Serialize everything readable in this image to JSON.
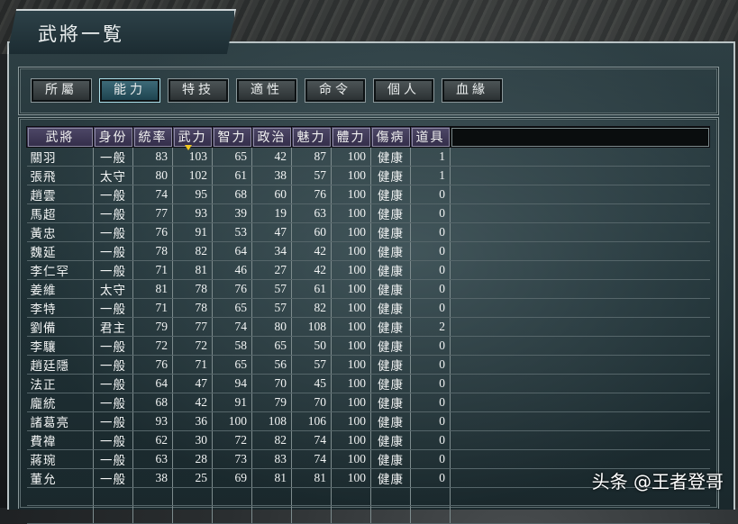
{
  "window": {
    "title": "武將一覧"
  },
  "tabs": [
    {
      "label": "所屬",
      "active": false
    },
    {
      "label": "能力",
      "active": true
    },
    {
      "label": "特技",
      "active": false
    },
    {
      "label": "適性",
      "active": false
    },
    {
      "label": "命令",
      "active": false
    },
    {
      "label": "個人",
      "active": false
    },
    {
      "label": "血緣",
      "active": false
    }
  ],
  "table": {
    "sorted_by": "武力",
    "sort_order": "descending",
    "headers": [
      "武將",
      "身份",
      "統率",
      "武力",
      "智力",
      "政治",
      "魅力",
      "體力",
      "傷病",
      "道具"
    ],
    "rows": [
      [
        "關羽",
        "一般",
        "83",
        "103",
        "65",
        "42",
        "87",
        "100",
        "健康",
        "1"
      ],
      [
        "張飛",
        "太守",
        "80",
        "102",
        "61",
        "38",
        "57",
        "100",
        "健康",
        "1"
      ],
      [
        "趙雲",
        "一般",
        "74",
        "95",
        "68",
        "60",
        "76",
        "100",
        "健康",
        "0"
      ],
      [
        "馬超",
        "一般",
        "77",
        "93",
        "39",
        "19",
        "63",
        "100",
        "健康",
        "0"
      ],
      [
        "黃忠",
        "一般",
        "76",
        "91",
        "53",
        "47",
        "60",
        "100",
        "健康",
        "0"
      ],
      [
        "魏延",
        "一般",
        "78",
        "82",
        "64",
        "34",
        "42",
        "100",
        "健康",
        "0"
      ],
      [
        "李仁罕",
        "一般",
        "71",
        "81",
        "46",
        "27",
        "42",
        "100",
        "健康",
        "0"
      ],
      [
        "姜維",
        "太守",
        "81",
        "78",
        "76",
        "57",
        "61",
        "100",
        "健康",
        "0"
      ],
      [
        "李特",
        "一般",
        "71",
        "78",
        "65",
        "57",
        "82",
        "100",
        "健康",
        "0"
      ],
      [
        "劉備",
        "君主",
        "79",
        "77",
        "74",
        "80",
        "108",
        "100",
        "健康",
        "2"
      ],
      [
        "李驤",
        "一般",
        "72",
        "72",
        "58",
        "65",
        "50",
        "100",
        "健康",
        "0"
      ],
      [
        "趙廷隱",
        "一般",
        "76",
        "71",
        "65",
        "56",
        "57",
        "100",
        "健康",
        "0"
      ],
      [
        "法正",
        "一般",
        "64",
        "47",
        "94",
        "70",
        "45",
        "100",
        "健康",
        "0"
      ],
      [
        "龐統",
        "一般",
        "68",
        "42",
        "91",
        "79",
        "70",
        "100",
        "健康",
        "0"
      ],
      [
        "諸葛亮",
        "一般",
        "93",
        "36",
        "100",
        "108",
        "106",
        "100",
        "健康",
        "0"
      ],
      [
        "費禕",
        "一般",
        "62",
        "30",
        "72",
        "82",
        "74",
        "100",
        "健康",
        "0"
      ],
      [
        "蔣琬",
        "一般",
        "63",
        "28",
        "73",
        "83",
        "74",
        "100",
        "健康",
        "0"
      ],
      [
        "董允",
        "一般",
        "38",
        "25",
        "69",
        "81",
        "81",
        "100",
        "健康",
        "0"
      ]
    ],
    "empty_rows": 2
  },
  "watermark": "头条 @王者登哥"
}
